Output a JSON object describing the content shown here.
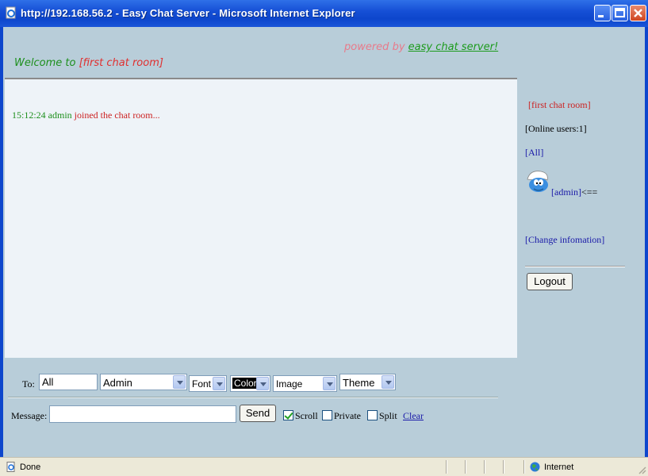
{
  "window": {
    "title": "http://192.168.56.2 - Easy Chat Server - Microsoft Internet Explorer"
  },
  "header": {
    "powered_prefix": "powered by",
    "powered_link": "easy chat server!",
    "welcome_prefix": "Welcome to",
    "room_name": "[first chat room]"
  },
  "chat": {
    "messages": [
      {
        "time": "15:12:24",
        "user": "admin",
        "text": "joined the chat room..."
      }
    ]
  },
  "sidebar": {
    "room": "[first chat room]",
    "online_users": "[Online users:1]",
    "all_link": "[All]",
    "user_link": "[admin]",
    "user_marker": "<==",
    "change_info": "[Change infomation]",
    "logout_label": "Logout"
  },
  "controls": {
    "to_label": "To:",
    "to_value": "All",
    "user_select": "Admin",
    "font_select": "Font",
    "color_select": "Color",
    "image_select": "Image",
    "theme_select": "Theme",
    "message_label": "Message:",
    "message_value": "",
    "send_label": "Send",
    "scroll_label": "Scroll",
    "scroll_checked": true,
    "private_label": "Private",
    "private_checked": false,
    "split_label": "Split",
    "split_checked": false,
    "clear_label": "Clear"
  },
  "statusbar": {
    "status": "Done",
    "zone": "Internet"
  },
  "icons": {
    "title_icon": "ie-page-icon",
    "avatar": "smurf-avatar-icon",
    "zone_icon": "globe-icon"
  }
}
